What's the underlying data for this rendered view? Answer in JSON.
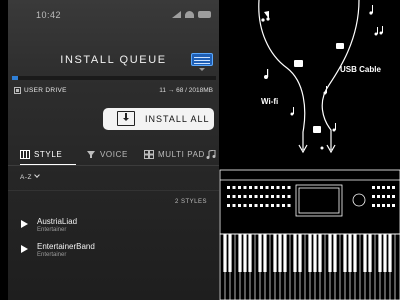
{
  "status": {
    "time": "10:42"
  },
  "header": {
    "title": "INSTALL QUEUE"
  },
  "progress": {
    "fraction": 0.03
  },
  "drive": {
    "label": "USER DRIVE",
    "count": "11 → 68 / 2018MB"
  },
  "install": {
    "label": "INSTALL ALL"
  },
  "tabs": [
    {
      "label": "STYLE",
      "active": true
    },
    {
      "label": "VOICE",
      "active": false
    },
    {
      "label": "MULTI PAD",
      "active": false
    }
  ],
  "sort": {
    "label": "A-Z"
  },
  "list": {
    "count_label": "2 STYLES",
    "items": [
      {
        "name": "AustriaLiad",
        "category": "Entertainer"
      },
      {
        "name": "EntertainerBand",
        "category": "Entertainer"
      }
    ]
  },
  "diagram": {
    "wifi_label": "Wi-fi",
    "usb_label": "USB Cable"
  },
  "colors": {
    "accent": "#2f7fd6",
    "background": "#000000"
  }
}
